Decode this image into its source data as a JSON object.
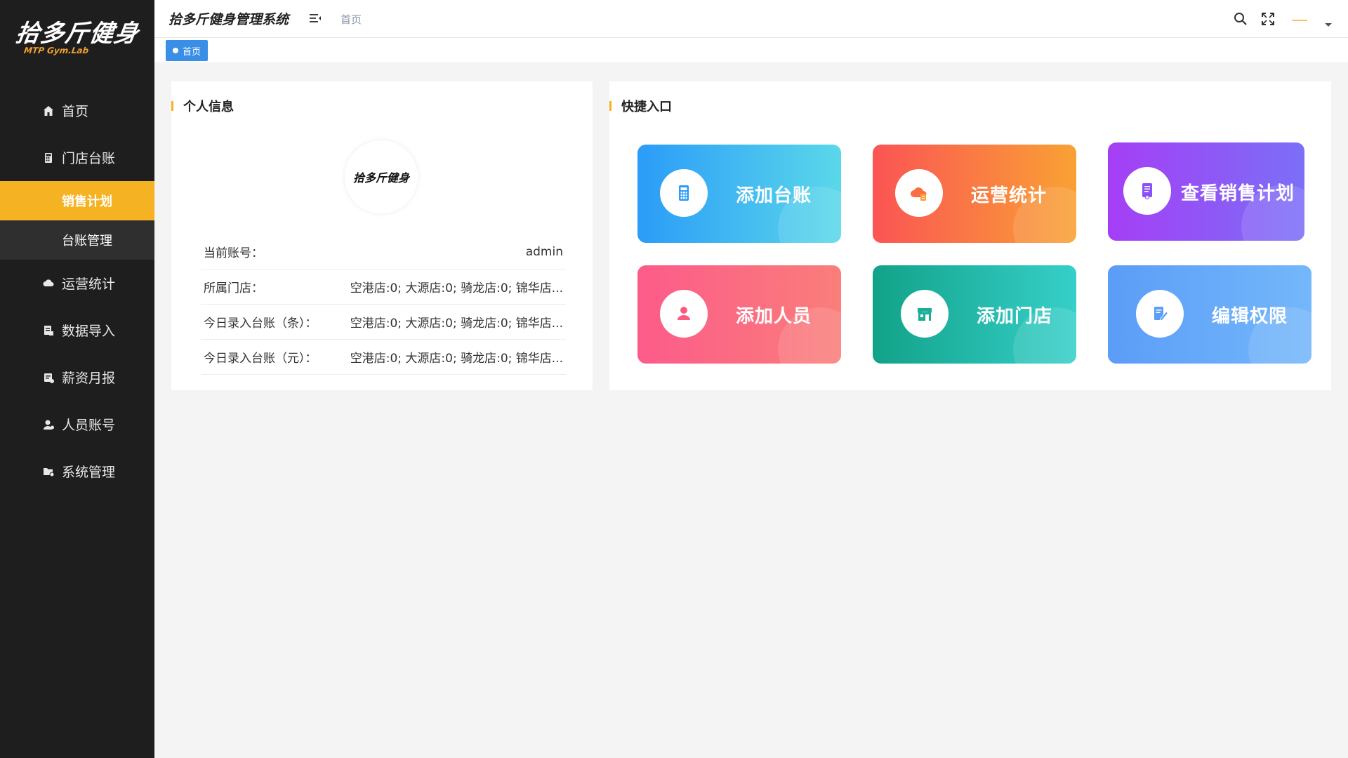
{
  "sidebar": {
    "logo_main": "拾多斤健身",
    "logo_sub": "MTP Gym.Lab",
    "items": [
      {
        "label": "首页"
      },
      {
        "label": "门店台账"
      },
      {
        "label": "运营统计"
      },
      {
        "label": "数据导入"
      },
      {
        "label": "薪资月报"
      },
      {
        "label": "人员账号"
      },
      {
        "label": "系统管理"
      }
    ],
    "submenu": [
      {
        "label": "销售计划",
        "active": true
      },
      {
        "label": "台账管理"
      }
    ]
  },
  "header": {
    "title": "拾多斤健身管理系统",
    "breadcrumb": "首页"
  },
  "tags": [
    {
      "label": "首页"
    }
  ],
  "profile": {
    "title": "个人信息",
    "avatar_text": "拾多斤健身",
    "rows": [
      {
        "key": "当前账号：",
        "value": "admin"
      },
      {
        "key": "所属门店：",
        "value": "空港店:0; 大源店:0; 骑龙店:0; 锦华店..."
      },
      {
        "key": "今日录入台账（条）：",
        "value": "空港店:0; 大源店:0; 骑龙店:0; 锦华店..."
      },
      {
        "key": "今日录入台账（元）：",
        "value": "空港店:0; 大源店:0; 骑龙店:0; 锦华店..."
      }
    ]
  },
  "quick": {
    "title": "快捷入口",
    "tiles": [
      {
        "label": "添加台账",
        "icon": "calculator-icon"
      },
      {
        "label": "运营统计",
        "icon": "cloud-data-icon"
      },
      {
        "label": "查看销售计划",
        "icon": "document-icon"
      },
      {
        "label": "添加人员",
        "icon": "person-icon"
      },
      {
        "label": "添加门店",
        "icon": "store-icon"
      },
      {
        "label": "编辑权限",
        "icon": "edit-document-icon"
      }
    ]
  },
  "colors": {
    "sidebar_bg": "#1e1e1e",
    "accent": "#f5b324",
    "tag_blue": "#3a8ee6"
  }
}
